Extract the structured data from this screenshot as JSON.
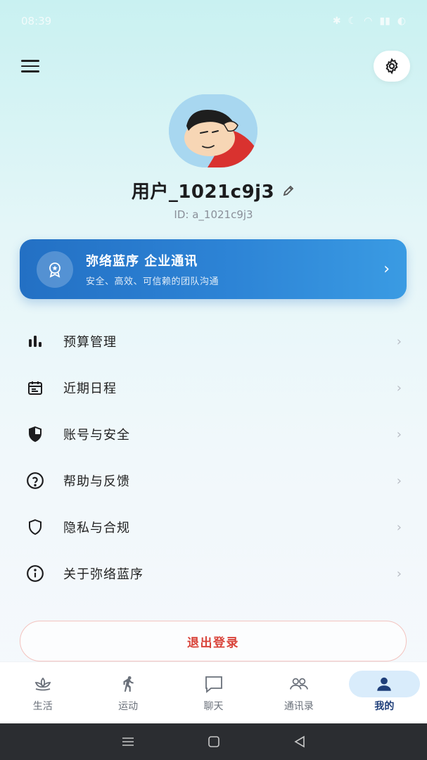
{
  "status_bar": {
    "time": "08:39"
  },
  "profile": {
    "username": "用户_1021c9j3",
    "user_id": "ID: a_1021c9j3"
  },
  "enterprise_card": {
    "title": "弥络蓝序 企业通讯",
    "subtitle": "安全、高效、可信赖的团队沟通",
    "icon": "medal-icon"
  },
  "menu": [
    {
      "label": "预算管理",
      "icon": "bar-chart-icon"
    },
    {
      "label": "近期日程",
      "icon": "calendar-icon"
    },
    {
      "label": "账号与安全",
      "icon": "security-shield-icon"
    },
    {
      "label": "帮助与反馈",
      "icon": "help-circle-icon"
    },
    {
      "label": "隐私与合规",
      "icon": "shield-outline-icon"
    },
    {
      "label": "关于弥络蓝序",
      "icon": "info-circle-icon"
    }
  ],
  "logout": {
    "label": "退出登录"
  },
  "tabs": [
    {
      "label": "生活",
      "icon": "lotus-icon"
    },
    {
      "label": "运动",
      "icon": "running-icon"
    },
    {
      "label": "聊天",
      "icon": "chat-bubble-icon"
    },
    {
      "label": "通讯录",
      "icon": "contacts-icon"
    },
    {
      "label": "我的",
      "icon": "person-icon",
      "active": true
    }
  ],
  "colors": {
    "accent": "#2370c4",
    "logout_red": "#d9433a",
    "active_tab": "#1f3f7a"
  }
}
